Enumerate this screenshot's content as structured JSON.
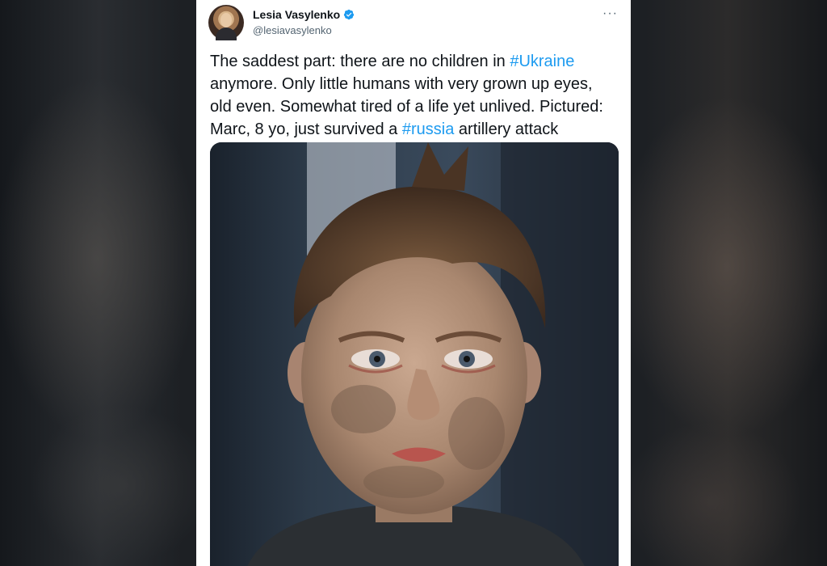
{
  "tweet": {
    "author": {
      "display_name": "Lesia Vasylenko",
      "handle": "@lesiavasylenko",
      "verified": true,
      "verified_color": "#1d9bf0"
    },
    "more_label": "···",
    "text_parts": {
      "p1": "The saddest part: there are no children in ",
      "tag1": "#Ukraine",
      "p2": " anymore. Only little humans with very grown up eyes, old even. Somewhat tired of a life yet unlived. Pictured: Marc, 8 yo, just survived a ",
      "tag2": "#russia",
      "p3": " artillery attack"
    },
    "hashtag_color": "#1d9bf0",
    "media": {
      "kind": "photo",
      "subject": "child-portrait"
    }
  },
  "icons": {
    "verified": "verified-badge-icon",
    "more": "more-options-icon"
  }
}
